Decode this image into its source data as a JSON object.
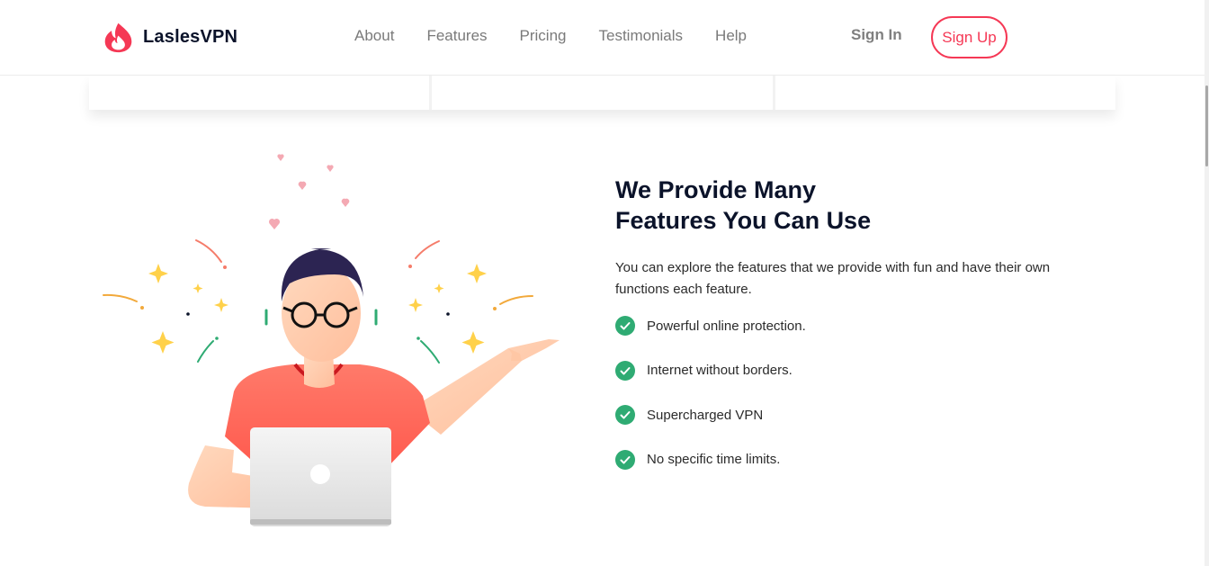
{
  "header": {
    "brand": "LaslesVPN",
    "nav": [
      "About",
      "Features",
      "Pricing",
      "Testimonials",
      "Help"
    ],
    "sign_in": "Sign In",
    "sign_up": "Sign Up"
  },
  "features_section": {
    "title_line1": "We Provide Many",
    "title_line2": "Features You Can Use",
    "description": "You can explore the features that we provide with fun and have their own functions each feature.",
    "items": [
      "Powerful online protection.",
      "Internet without borders.",
      "Supercharged VPN",
      "No specific time limits."
    ]
  },
  "colors": {
    "accent": "#F53855",
    "check": "#2FAB73",
    "heading": "#0B132A"
  }
}
